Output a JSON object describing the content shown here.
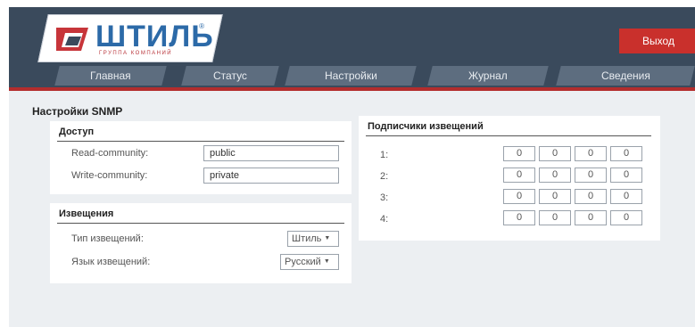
{
  "header": {
    "logo": {
      "text": "ШТИЛЬ",
      "subtitle": "ГРУППА КОМПАНИЙ",
      "reg": "®"
    },
    "logout_label": "Выход"
  },
  "nav": {
    "tabs": [
      {
        "label": "Главная"
      },
      {
        "label": "Статус"
      },
      {
        "label": "Настройки"
      },
      {
        "label": "Журнал"
      },
      {
        "label": "Сведения"
      }
    ]
  },
  "page": {
    "title": "Настройки SNMP"
  },
  "access": {
    "title": "Доступ",
    "read_label": "Read-community:",
    "read_value": "public",
    "write_label": "Write-community:",
    "write_value": "private"
  },
  "notifications": {
    "title": "Извещения",
    "type_label": "Тип извещений:",
    "type_value": "Штиль",
    "lang_label": "Язык извещений:",
    "lang_value": "Русский"
  },
  "subscribers": {
    "title": "Подписчики извещений",
    "rows": [
      {
        "label": "1:",
        "octets": [
          "0",
          "0",
          "0",
          "0"
        ]
      },
      {
        "label": "2:",
        "octets": [
          "0",
          "0",
          "0",
          "0"
        ]
      },
      {
        "label": "3:",
        "octets": [
          "0",
          "0",
          "0",
          "0"
        ]
      },
      {
        "label": "4:",
        "octets": [
          "0",
          "0",
          "0",
          "0"
        ]
      }
    ]
  },
  "colors": {
    "header_bg": "#3a4a5c",
    "nav_tab": "#5d6d7f",
    "accent_red": "#b32d2d",
    "logout_bg": "#c9302c",
    "content_bg": "#eceff2"
  }
}
